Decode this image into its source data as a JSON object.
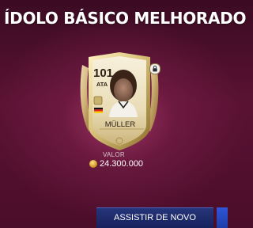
{
  "header": {
    "title": "ÍDOLO BÁSICO MELHORADO"
  },
  "card": {
    "rating": "101",
    "position": "ATA",
    "player_name": "MÜLLER",
    "nation_flag": "germany-flag-icon",
    "locked_icon": "lock-icon"
  },
  "value": {
    "label": "VALOR",
    "amount": "24.300.000",
    "currency_icon": "coin-icon"
  },
  "actions": {
    "replay_label": "ASSISTIR DE NOVO"
  },
  "colors": {
    "background": "#4a0d2a",
    "card_gold": "#d8c27a",
    "button_blue": "#1d2a6a",
    "accent_blue": "#2f55d6"
  }
}
